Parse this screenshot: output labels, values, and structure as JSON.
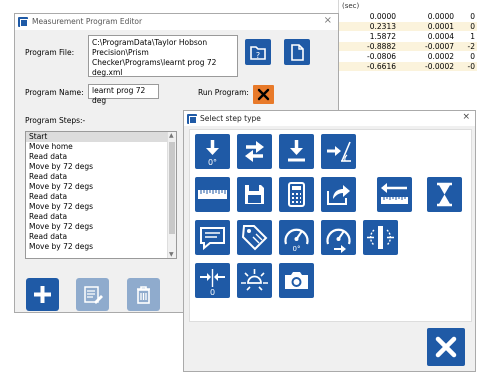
{
  "background_table": {
    "header": "(sec)",
    "rows": [
      [
        "0.0000",
        "0.0000",
        "0"
      ],
      [
        "0.2313",
        "0.0001",
        "0"
      ],
      [
        "1.5872",
        "0.0004",
        "1"
      ],
      [
        "-0.8882",
        "-0.0007",
        "-2"
      ],
      [
        "-0.0806",
        "0.0002",
        "0"
      ],
      [
        "-0.6616",
        "-0.0002",
        "-0"
      ]
    ]
  },
  "program_editor": {
    "title": "Measurement Program Editor",
    "close_glyph": "×",
    "program_file_label": "Program File:",
    "program_file_value": "C:\\ProgramData\\Taylor Hobson Precision\\Prism Checker\\Programs\\learnt prog 72 deg.xml",
    "program_name_label": "Program Name:",
    "program_name_value": "learnt prog 72 deg",
    "run_program_label": "Run Program:",
    "program_steps_label": "Program Steps:-",
    "steps": [
      "Start",
      "Move home",
      "Read data",
      "Move by 72 degs",
      "Read data",
      "Move by 72 degs",
      "Read data",
      "Move by 72 degs",
      "Read data",
      "Move by 72 degs",
      "Read data",
      "Move by 72 degs"
    ]
  },
  "step_dialog": {
    "title": "Select step type",
    "close_glyph": "×",
    "tiles": [
      {
        "name": "move-home-icon",
        "text": "0°"
      },
      {
        "name": "move-by-icon",
        "text": ""
      },
      {
        "name": "read-data-icon",
        "text": ""
      },
      {
        "name": "move-angle-icon",
        "text": ""
      },
      {
        "name": "ruler-icon",
        "text": ""
      },
      {
        "name": "save-icon",
        "text": ""
      },
      {
        "name": "calculator-icon",
        "text": ""
      },
      {
        "name": "export-icon",
        "text": ""
      },
      {
        "name": "measure-width-icon",
        "text": ""
      },
      {
        "name": "hourglass-icon",
        "text": ""
      },
      {
        "name": "message-icon",
        "text": ""
      },
      {
        "name": "tag-icon",
        "text": ""
      },
      {
        "name": "gauge-zero-icon",
        "text": "0°"
      },
      {
        "name": "gauge-move-icon",
        "text": ""
      },
      {
        "name": "flip-icon",
        "text": ""
      },
      {
        "name": "zero-reference-icon",
        "text": "0"
      },
      {
        "name": "brightness-icon",
        "text": ""
      },
      {
        "name": "camera-icon",
        "text": ""
      }
    ]
  }
}
